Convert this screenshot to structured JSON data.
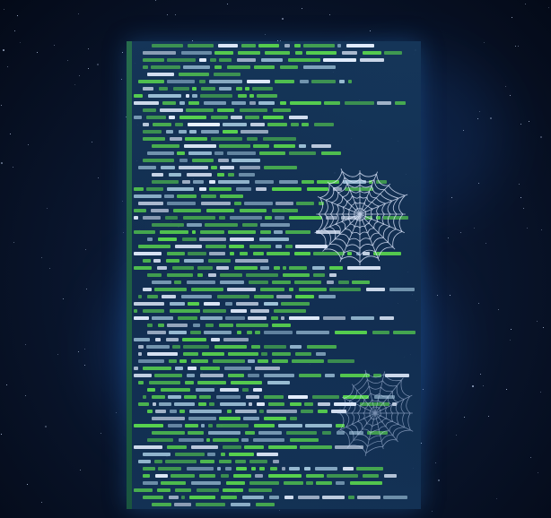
{
  "scene": "code-panel-over-starfield",
  "icons": [
    "spider-web-icon",
    "spider-web-icon"
  ],
  "colors": {
    "code_green": "#58d24e",
    "code_white": "#e6f0ff",
    "code_dim": "#9fc3d9",
    "panel_bg": "#16385c",
    "web_stroke": "#dfe9ff"
  },
  "code_lines": 65
}
